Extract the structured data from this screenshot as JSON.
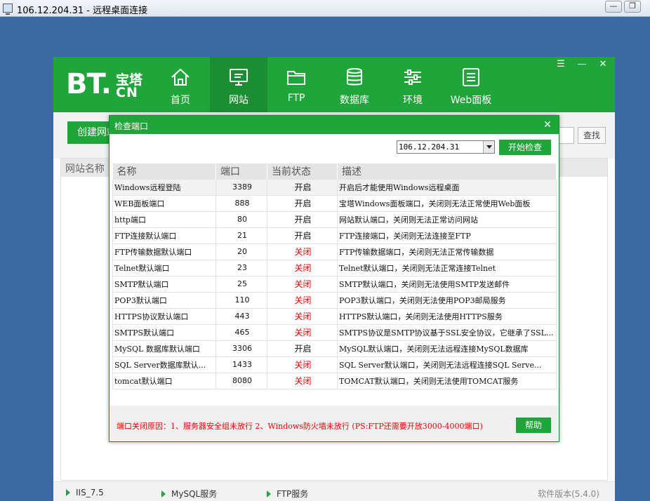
{
  "rdp": {
    "title": "106.12.204.31 - 远程桌面连接",
    "minimize_glyph": "—",
    "restore_glyph": "❐"
  },
  "panel": {
    "logo_main": "BT.",
    "logo_cn_top": "宝塔",
    "logo_cn_bot": "CN",
    "nav": [
      {
        "label": "首页",
        "icon": "home-icon"
      },
      {
        "label": "网站",
        "icon": "monitor-icon"
      },
      {
        "label": "FTP",
        "icon": "folder-icon"
      },
      {
        "label": "数据库",
        "icon": "database-icon"
      },
      {
        "label": "环境",
        "icon": "sliders-icon"
      },
      {
        "label": "Web面板",
        "icon": "list-icon"
      }
    ],
    "active_nav": "网站",
    "header_controls": {
      "menu": "☰",
      "minimize": "—",
      "close": "✕"
    },
    "create_button": "创建网站",
    "search_button": "查找",
    "site_name_header": "网站名称",
    "services": [
      "IIS_7.5",
      "MySQL服务",
      "FTP服务"
    ],
    "version": "软件版本(5.4.0)"
  },
  "dialog": {
    "title": "检查端口",
    "close": "✕",
    "ip_selected": "106.12.204.31",
    "start_button": "开始检查",
    "columns": [
      "名称",
      "端口",
      "当前状态",
      "描述"
    ],
    "rows": [
      {
        "name": "Windows远程登陆",
        "port": "3389",
        "status": "开启",
        "desc": "开启后才能使用Windows远程桌面"
      },
      {
        "name": "WEB面板端口",
        "port": "888",
        "status": "开启",
        "desc": "宝塔Windows面板端口，关闭则无法正常使用Web面板"
      },
      {
        "name": "http端口",
        "port": "80",
        "status": "开启",
        "desc": "网站默认端口，关闭则无法正常访问网站"
      },
      {
        "name": "FTP连接默认端口",
        "port": "21",
        "status": "开启",
        "desc": "FTP连接端口，关闭则无法连接至FTP"
      },
      {
        "name": "FTP传输数据默认端口",
        "port": "20",
        "status": "关闭",
        "desc": "FTP传输数据端口，关闭则无法正常传输数据"
      },
      {
        "name": "Telnet默认端口",
        "port": "23",
        "status": "关闭",
        "desc": "Telnet默认端口，关闭则无法正常连接Telnet"
      },
      {
        "name": "SMTP默认端口",
        "port": "25",
        "status": "关闭",
        "desc": "SMTP默认端口，关闭则无法使用SMTP发送邮件"
      },
      {
        "name": "POP3默认端口",
        "port": "110",
        "status": "关闭",
        "desc": "POP3默认端口，关闭则无法使用POP3邮局服务"
      },
      {
        "name": "HTTPS协议默认端口",
        "port": "443",
        "status": "关闭",
        "desc": "HTTPS默认端口，关闭则无法使用HTTPS服务"
      },
      {
        "name": "SMTPS默认端口",
        "port": "465",
        "status": "关闭",
        "desc": "SMTPS协议是SMTP协议基于SSL安全协议，它继承了SSL..."
      },
      {
        "name": "MySQL 数据库默认端口",
        "port": "3306",
        "status": "开启",
        "desc": "MySQL默认端口，关闭则无法远程连接MySQL数据库"
      },
      {
        "name": "SQL Server数据库默认...",
        "port": "1433",
        "status": "关闭",
        "desc": "SQL Server默认端口，关闭则无法远程连接SQL Serve..."
      },
      {
        "name": "tomcat默认端口",
        "port": "8080",
        "status": "关闭",
        "desc": "TOMCAT默认端口，关闭则无法使用TOMCAT服务"
      }
    ],
    "note": "端口关闭原因：1、服务器安全组未放行  2、Windows防火墙未放行 (PS:FTP还需要开放3000-4000端口)",
    "help_button": "帮助"
  },
  "colors": {
    "brand": "#20a53a",
    "brand_dark": "#1a8e31",
    "off": "#ee0000",
    "desktop": "#3b6aa3"
  }
}
